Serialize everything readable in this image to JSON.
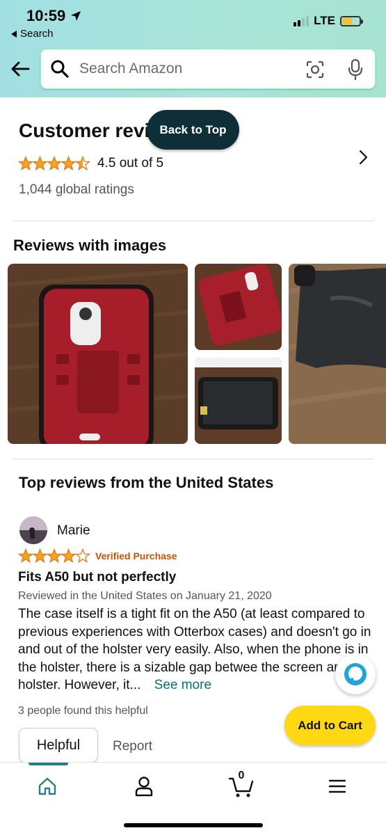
{
  "status_bar": {
    "time": "10:59",
    "back_app": "Search",
    "network": "LTE"
  },
  "search": {
    "placeholder": "Search Amazon"
  },
  "customer_reviews": {
    "title": "Customer reviews",
    "rating_text": "4.5 out of 5",
    "rating_value": 4.5,
    "global_ratings": "1,044 global ratings"
  },
  "back_to_top_label": "Back to Top",
  "reviews_with_images": {
    "title": "Reviews with images"
  },
  "top_reviews": {
    "title": "Top reviews from the United States",
    "review": {
      "reviewer": "Marie",
      "stars": 4,
      "verified": "Verified Purchase",
      "title": "Fits A50 but not perfectly",
      "meta": "Reviewed in the United States on January 21, 2020",
      "body": "The case itself is a tight fit on the A50 (at least compared to previous experiences with Otterbox cases) and doesn't go in and out of the holster very easily. Also, when the phone is in the holster, there is a sizable gap betwee the screen and the holster. However, it...",
      "see_more": "See more",
      "helpful_count": "3 people found this helpful",
      "helpful_label": "Helpful",
      "report_label": "Report"
    }
  },
  "add_to_cart_label": "Add to Cart",
  "bottom_nav": {
    "cart_count": "0"
  },
  "colors": {
    "star": "#f4a41d",
    "accent": "#007185",
    "verified": "#c45500",
    "cart_button": "#ffd814",
    "back_to_top": "#0f2f38"
  }
}
